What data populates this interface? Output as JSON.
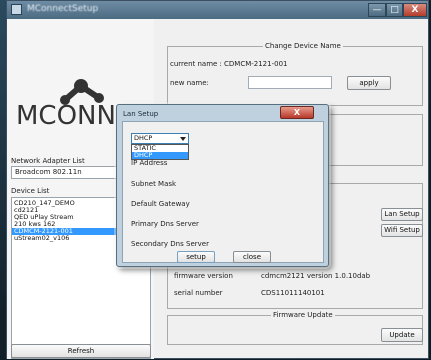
{
  "window": {
    "title": "MConnectSetup",
    "minimize_glyph": "—",
    "maximize_glyph": "□",
    "close_glyph": "X"
  },
  "sidebar": {
    "logo_text": "MCONNECT",
    "network_adapter_label": "Network Adapter List",
    "network_adapter_value": "Broadcom 802.11n",
    "device_list_label": "Device List",
    "devices": [
      {
        "label": "CD210_147_DEMO",
        "selected": false
      },
      {
        "label": "cd2121",
        "selected": false
      },
      {
        "label": "QED uPlay Stream",
        "selected": false
      },
      {
        "label": "210 kws 162",
        "selected": false
      },
      {
        "label": "CDMCM-2121-001",
        "selected": true
      },
      {
        "label": "uStream02_v106",
        "selected": false
      }
    ],
    "refresh_label": "Refresh"
  },
  "change_name": {
    "title": "Change Device Name",
    "current_name_label": "current name :",
    "current_name_value": "CDMCM-2121-001",
    "new_name_label": "new name:",
    "new_name_value": "",
    "apply_label": "apply"
  },
  "device_actions": {
    "lan_setup_label": "Lan Setup",
    "wifi_setup_label": "Wifi Setup"
  },
  "info": {
    "firmware_version_label": "firmware version",
    "firmware_version_value": "cdmcm2121 version 1.0.10dab",
    "serial_number_label": "serial number",
    "serial_number_value": "CDS11011140101"
  },
  "firmware_update": {
    "title": "Firmware Update",
    "update_label": "Update"
  },
  "lan_dialog": {
    "title": "Lan Setup",
    "close_glyph": "X",
    "mode_selected": "DHCP",
    "mode_options": [
      {
        "label": "STATIC",
        "selected": false
      },
      {
        "label": "DHCP",
        "selected": true
      }
    ],
    "ip_address_label": "IP Address",
    "subnet_mask_label": "Subnet Mask",
    "default_gateway_label": "Default Gateway",
    "primary_dns_label": "Primary Dns Server",
    "secondary_dns_label": "Secondary Dns Server",
    "setup_label": "setup",
    "close_label": "close"
  }
}
